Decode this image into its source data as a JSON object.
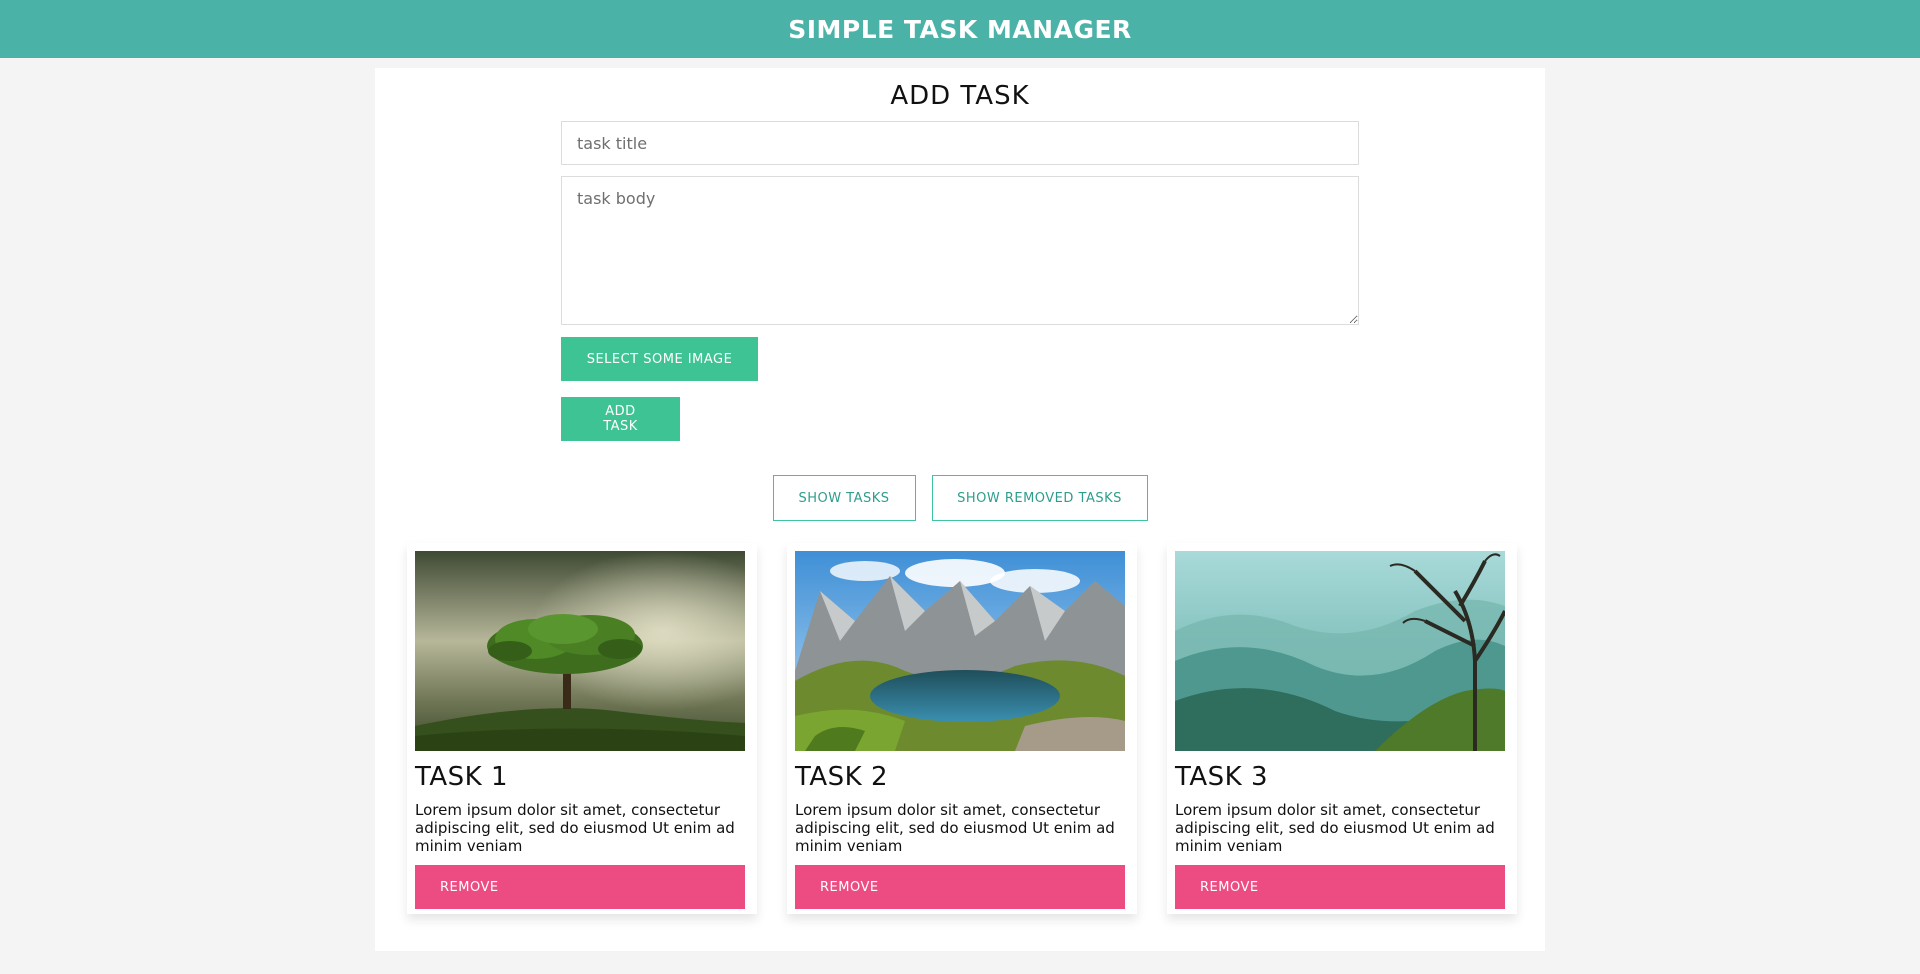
{
  "header": {
    "title": "SIMPLE TASK MANAGER",
    "bg_color": "#4bb2a8"
  },
  "form": {
    "heading": "ADD TASK",
    "title_placeholder": "task title",
    "body_placeholder": "task body",
    "select_image_label": "SELECT SOME IMAGE",
    "add_task_label": "ADD TASK",
    "button_color": "#3ec394"
  },
  "toggles": {
    "show_tasks_label": "SHOW TASKS",
    "show_removed_label": "SHOW REMOVED TASKS"
  },
  "tasks": [
    {
      "title": "TASK 1",
      "body": "Lorem ipsum dolor sit amet, consectetur adipiscing elit, sed do eiusmod Ut enim ad minim veniam",
      "image": "tree-on-hill-photo",
      "remove_label": "REMOVE"
    },
    {
      "title": "TASK 2",
      "body": "Lorem ipsum dolor sit amet, consectetur adipiscing elit, sed do eiusmod Ut enim ad minim veniam",
      "image": "mountain-lake-photo",
      "remove_label": "REMOVE"
    },
    {
      "title": "TASK 3",
      "body": "Lorem ipsum dolor sit amet, consectetur adipiscing elit, sed do eiusmod Ut enim ad minim veniam",
      "image": "misty-valley-photo",
      "remove_label": "REMOVE"
    }
  ],
  "colors": {
    "remove_button": "#ec4c82",
    "accent": "#3ec394"
  }
}
